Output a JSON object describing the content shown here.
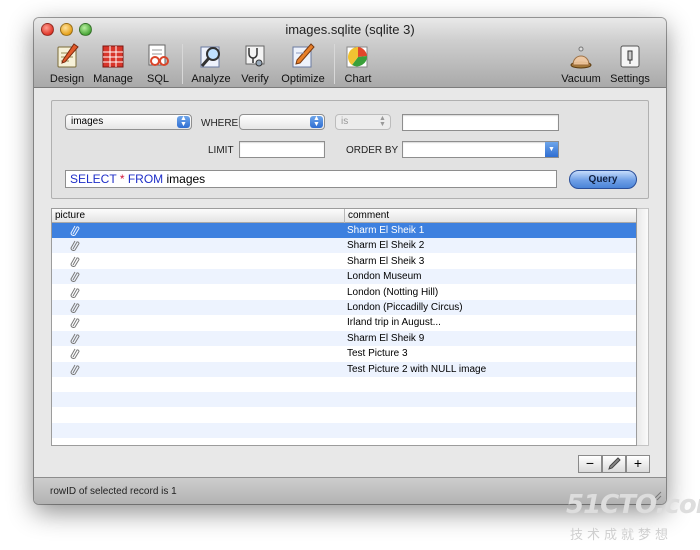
{
  "window": {
    "title": "images.sqlite (sqlite 3)"
  },
  "toolbar": {
    "items": [
      {
        "label": "Design",
        "icon": "design-icon"
      },
      {
        "label": "Manage",
        "icon": "manage-icon"
      },
      {
        "label": "SQL",
        "icon": "sql-icon"
      },
      {
        "label": "Analyze",
        "icon": "analyze-icon"
      },
      {
        "label": "Verify",
        "icon": "verify-icon"
      },
      {
        "label": "Optimize",
        "icon": "optimize-icon"
      },
      {
        "label": "Chart",
        "icon": "chart-icon"
      },
      {
        "label": "Vacuum",
        "icon": "vacuum-icon"
      },
      {
        "label": "Settings",
        "icon": "settings-icon"
      }
    ]
  },
  "query": {
    "table_select": "images",
    "where_label": "WHERE",
    "where_column": "",
    "operator": "is",
    "where_value": "",
    "limit_label": "LIMIT",
    "limit_value": "",
    "order_by_label": "ORDER BY",
    "order_by_value": "",
    "sql_parts": {
      "select": "SELECT",
      "star": "*",
      "from": "FROM",
      "table": "images"
    },
    "query_button": "Query"
  },
  "table": {
    "columns": [
      "picture",
      "comment"
    ],
    "rows": [
      "Sharm El Sheik 1",
      "Sharm El Sheik 2",
      "Sharm El Sheik 3",
      "London Museum",
      "London (Notting Hill)",
      "London (Piccadilly Circus)",
      "Irland trip in August...",
      "Sharm El Sheik 9",
      "Test Picture 3",
      "Test Picture 2 with NULL image"
    ],
    "selected_index": 0
  },
  "buttons": {
    "remove": "−",
    "edit_icon": "pencil-icon",
    "add": "+"
  },
  "status": {
    "text": "rowID of selected record is 1"
  },
  "watermark": {
    "brand": "51CTO.com",
    "tagline": "技术成就梦想"
  },
  "colors": {
    "selection": "#3d80df",
    "accent": "#2f6ed2"
  }
}
